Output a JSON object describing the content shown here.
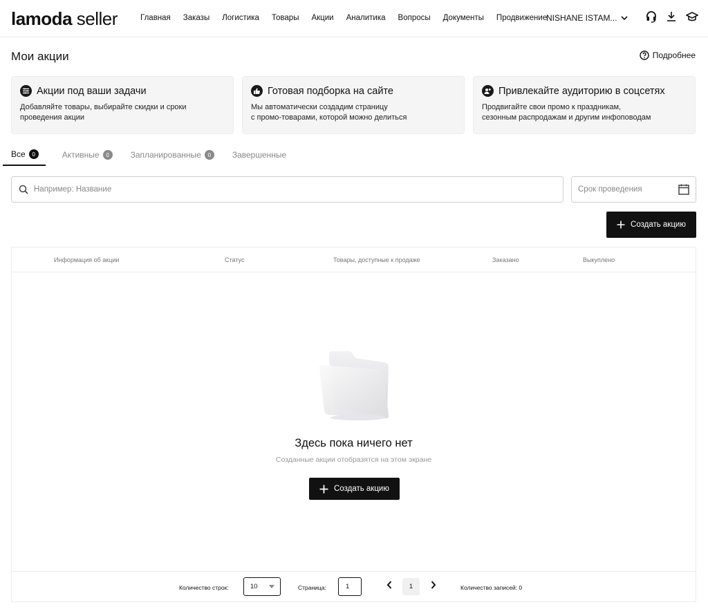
{
  "header": {
    "brand": "lamoda",
    "brand_sub": "seller",
    "nav": [
      "Главная",
      "Заказы",
      "Логистика",
      "Товары",
      "Акции",
      "Аналитика",
      "Вопросы",
      "Документы",
      "Продвижение"
    ],
    "account": "NISHANE ISTAM...",
    "icons": [
      "headset-icon",
      "download-icon",
      "graduation-cap-icon"
    ]
  },
  "page": {
    "title": "Мои акции",
    "more_link": "Подробнее"
  },
  "cards": [
    {
      "title": "Акции под ваши задачи",
      "body": "Добавляйте товары, выбирайте скидки и сроки\nпроведения акции",
      "icon": "sliders-icon"
    },
    {
      "title": "Готовая подборка на сайте",
      "body": "Мы автоматически создадим страницу\nс промо-товарами, которой можно делиться",
      "icon": "thumbs-up-icon"
    },
    {
      "title": "Привлекайте аудиторию в соцсетях",
      "body": "Продвигайте свои промо к праздникам,\nсезонным распродажам и другим инфоповодам",
      "icon": "people-icon"
    }
  ],
  "tabs": [
    {
      "label": "Все",
      "count": "0",
      "active": true
    },
    {
      "label": "Активные",
      "count": "0",
      "active": false
    },
    {
      "label": "Запланированные",
      "count": "0",
      "active": false
    },
    {
      "label": "Завершенные",
      "count": "",
      "active": false
    }
  ],
  "filters": {
    "search_placeholder": "Например: Название",
    "date_placeholder": "Срок проведения"
  },
  "create_label": "Создать акцию",
  "table": {
    "columns": [
      "Информация об акции",
      "Статус",
      "Товары, доступные к продаже",
      "Заказано",
      "Выкуплено"
    ],
    "empty_title": "Здесь пока ничего нет",
    "empty_sub": "Созданные акции отобразятся на этом экране",
    "create_label": "Создать акцию"
  },
  "footer": {
    "rows_label": "Количество строк:",
    "rows_value": "10",
    "page_label": "Страница:",
    "page_value": "1",
    "current_page": "1",
    "records_label": "Количество записей: 0"
  }
}
